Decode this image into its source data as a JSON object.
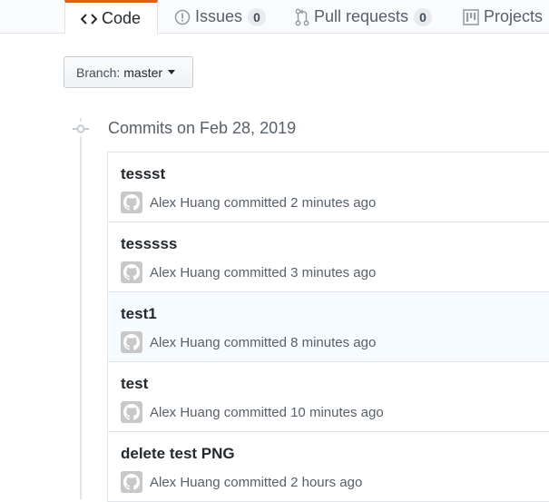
{
  "tabs": {
    "code": {
      "label": "Code"
    },
    "issues": {
      "label": "Issues",
      "count": "0"
    },
    "pulls": {
      "label": "Pull requests",
      "count": "0"
    },
    "projects": {
      "label": "Projects"
    }
  },
  "branch": {
    "prefix": "Branch:",
    "name": "master"
  },
  "commits_heading": "Commits on Feb 28, 2019",
  "commits": [
    {
      "title": "tessst",
      "author": "Alex Huang",
      "verb": "committed",
      "time": "2 minutes ago"
    },
    {
      "title": "tesssss",
      "author": "Alex Huang",
      "verb": "committed",
      "time": "3 minutes ago"
    },
    {
      "title": "test1",
      "author": "Alex Huang",
      "verb": "committed",
      "time": "8 minutes ago"
    },
    {
      "title": "test",
      "author": "Alex Huang",
      "verb": "committed",
      "time": "10 minutes ago"
    },
    {
      "title": "delete test PNG",
      "author": "Alex Huang",
      "verb": "committed",
      "time": "2 hours ago"
    }
  ],
  "colors": {
    "selected_tab_accent": "#e36209",
    "hover_row": "#f6fbff"
  }
}
